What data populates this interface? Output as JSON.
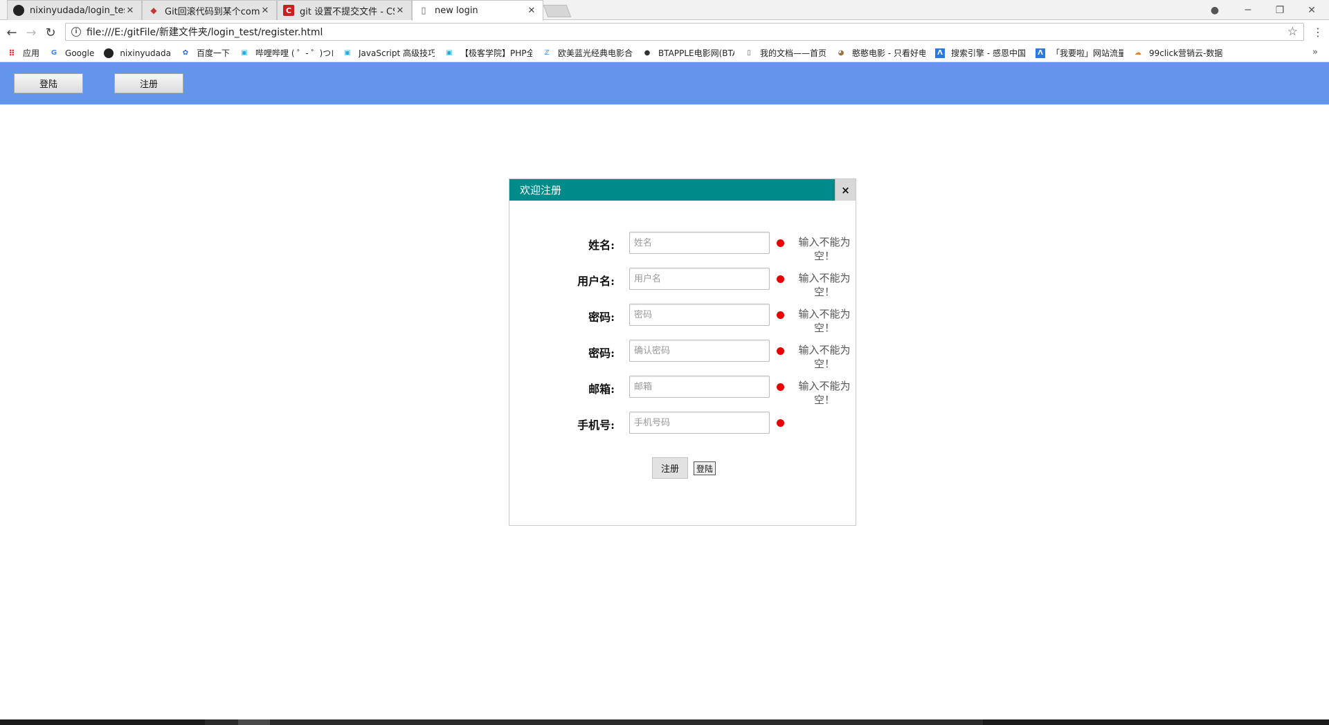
{
  "browser": {
    "tabs": [
      {
        "title": "nixinyudada/login_test",
        "icon": "github-icon",
        "active": false
      },
      {
        "title": "Git回滚代码到某个comm",
        "icon": "git-icon",
        "active": false
      },
      {
        "title": "git 设置不提交文件 - CSI",
        "icon": "csdn-icon",
        "active": false
      },
      {
        "title": "new login",
        "icon": "page-icon",
        "active": true
      }
    ],
    "url": "file:///E:/gitFile/新建文件夹/login_test/register.html",
    "bookmarks": [
      {
        "label": "应用",
        "icon": "apps-icon"
      },
      {
        "label": "Google",
        "icon": "google-icon"
      },
      {
        "label": "nixinyudada",
        "icon": "github-icon"
      },
      {
        "label": "百度一下",
        "icon": "baidu-icon"
      },
      {
        "label": "哔哩哔哩 ( ゜- ゜)つロ",
        "icon": "bilibili-icon"
      },
      {
        "label": "JavaScript 高级技巧",
        "icon": "bilibili-icon"
      },
      {
        "label": "【极客学院】PHP全",
        "icon": "bilibili-icon"
      },
      {
        "label": "欧美蓝光经典电影合",
        "icon": "zhihu-icon"
      },
      {
        "label": "BTAPPLE电影网(BTA",
        "icon": "apple-icon"
      },
      {
        "label": "我的文档——首页",
        "icon": "doc-icon"
      },
      {
        "label": "憨憨电影 - 只看好电",
        "icon": "dog-icon"
      },
      {
        "label": "搜索引擎 - 感恩中国",
        "icon": "a-icon"
      },
      {
        "label": "「我要啦」网站流量",
        "icon": "a-icon"
      },
      {
        "label": "99click营销云-数据",
        "icon": "cloud-icon"
      }
    ]
  },
  "header": {
    "login_label": "登陆",
    "register_label": "注册"
  },
  "dialog": {
    "title": "欢迎注册",
    "close_glyph": "×",
    "fields": [
      {
        "label": "姓名:",
        "placeholder": "姓名",
        "error": "输入不能为空！"
      },
      {
        "label": "用户名:",
        "placeholder": "用户名",
        "error": "输入不能为空！"
      },
      {
        "label": "密码:",
        "placeholder": "密码",
        "error": "输入不能为空！"
      },
      {
        "label": "密码:",
        "placeholder": "确认密码",
        "error": "输入不能为空！"
      },
      {
        "label": "邮箱:",
        "placeholder": "邮箱",
        "error": "输入不能为空！"
      },
      {
        "label": "手机号:",
        "placeholder": "手机号码",
        "error": ""
      }
    ],
    "register_button": "注册",
    "login_button": "登陆"
  },
  "colors": {
    "header_bg": "#6495ed",
    "dialog_title_bg": "#008b8b",
    "error_dot": "#e80000"
  }
}
